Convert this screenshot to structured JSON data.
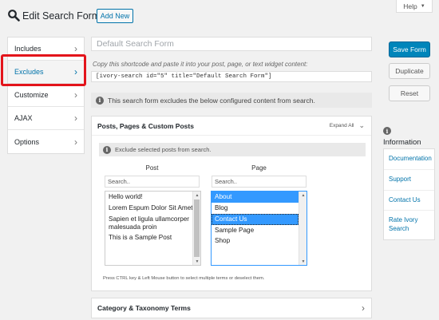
{
  "header": {
    "title": "Edit Search Form",
    "add_new": "Add New",
    "help": "Help"
  },
  "tabs": [
    {
      "label": "Includes"
    },
    {
      "label": "Excludes"
    },
    {
      "label": "Customize"
    },
    {
      "label": "AJAX"
    },
    {
      "label": "Options"
    }
  ],
  "form": {
    "name_placeholder": "Default Search Form",
    "copy_text": "Copy this shortcode and paste it into your post, page, or text widget content:",
    "shortcode": "[ivory-search id=\"5\" title=\"Default Search Form\"]",
    "notice": "This search form excludes the below configured content from search."
  },
  "panel": {
    "title": "Posts, Pages & Custom Posts",
    "expand_all": "Expand All",
    "notice": "Exclude selected posts from search.",
    "post": {
      "label": "Post",
      "search_placeholder": "Search..",
      "items": [
        "Hello world!",
        "Lorem Espum Dolor Sit Amet",
        "Sapien et ligula ullamcorper malesuada proin",
        "This is a Sample Post"
      ]
    },
    "page": {
      "label": "Page",
      "search_placeholder": "Search..",
      "items": [
        "About",
        "Blog",
        "Contact Us",
        "Sample Page",
        "Shop"
      ],
      "selected": [
        "About",
        "Contact Us"
      ]
    },
    "hint": "Press CTRL key & Left Mouse button to select multiple terms or deselect them."
  },
  "category_panel": {
    "title": "Category & Taxonomy Terms"
  },
  "actions": {
    "save": "Save Form",
    "duplicate": "Duplicate",
    "reset": "Reset"
  },
  "info": {
    "title": "Information",
    "links": [
      "Documentation",
      "Support",
      "Contact Us",
      "Rate Ivory Search"
    ]
  },
  "colors": {
    "accent": "#0085ba",
    "highlight": "#e3141b",
    "selection": "#3399ff"
  }
}
